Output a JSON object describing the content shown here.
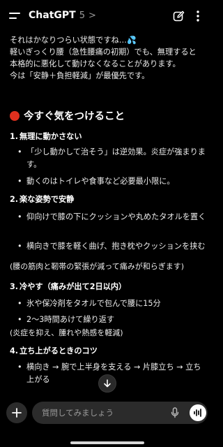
{
  "header": {
    "title": "ChatGPT",
    "model_version": "5",
    "chevron": ">",
    "menu_icon": "hamburger-menu-icon",
    "edit_icon": "new-chat-edit-icon",
    "more_icon": "vertical-dots-icon"
  },
  "message": {
    "intro": [
      "それはかなりつらい状態ですね…",
      "軽いぎっくり腰（急性腰痛の初期）でも、無理すると",
      "本格的に悪化して動けなくなることがあります。",
      "今は「安静＋負担軽減」が最優先です。"
    ],
    "heading": "今すぐ気をつけること",
    "sections": [
      {
        "number": "1.",
        "title": "無理に動かさない",
        "bullets": [
          [
            "「少し動かして治そう」は逆効果。炎症が強まりま",
            "す。"
          ],
          [
            "動くのはトイレや食事など必要最小限に。"
          ]
        ]
      },
      {
        "number": "2.",
        "title": "楽な姿勢で安静",
        "bullets": [
          [
            "仰向けで膝の下にクッションや丸めたタオルを置く"
          ],
          [
            "横向きで膝を軽く曲げ、抱き枕やクッションを挟む"
          ]
        ],
        "note": "(腰の筋肉と靭帯の緊張が減って痛みが和らぎます)"
      },
      {
        "number": "3.",
        "title": "冷やす（痛みが出て2日以内）",
        "bullets": [
          [
            "氷や保冷剤をタオルで包んで腰に15分"
          ],
          [
            "2〜3時間あけて繰り返す"
          ]
        ],
        "note": "(炎症を抑え、腫れや熱感を軽減)"
      },
      {
        "number": "4.",
        "title": "立ち上がるときのコツ",
        "bullets": [
          [
            "横向き → 腕で上半身を支える → 片膝立ち → 立ち",
            "上がる"
          ]
        ]
      }
    ]
  },
  "composer": {
    "placeholder": "質問してみましょう",
    "add_icon": "plus-icon",
    "mic_icon": "microphone-icon",
    "voice_icon": "voice-waveform-icon",
    "scroll_icon": "arrow-down-icon"
  },
  "colors": {
    "background": "#000000",
    "text": "#ececec",
    "accent_dot": "#e0301e",
    "input_bg": "#2b2b2b"
  }
}
